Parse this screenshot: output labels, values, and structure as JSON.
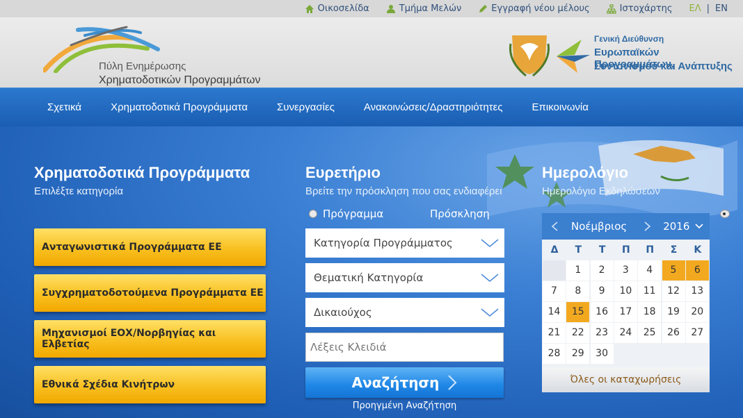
{
  "topbar": {
    "links": [
      {
        "label": "Οικοσελίδα",
        "icon": "home-icon"
      },
      {
        "label": "Τμήμα Μελών",
        "icon": "user-icon"
      },
      {
        "label": "Εγγραφή νέου μέλους",
        "icon": "pencil-icon"
      },
      {
        "label": "Ιστοχάρτης",
        "icon": "sitemap-icon"
      }
    ],
    "lang_el": "ΕΛ",
    "lang_sep": "|",
    "lang_en": "EN"
  },
  "header": {
    "logo_line1": "Πύλη Ενημέρωσης",
    "logo_line2": "Χρηματοδοτικών Προγραμμάτων",
    "org_small": "Γενική Διεύθυνση",
    "org_line1": "Ευρωπαϊκών Προγραμμάτων,",
    "org_line2": "Συντονισμού και Ανάπτυξης"
  },
  "nav": {
    "items": [
      "Σχετικά",
      "Χρηματοδοτικά Προγράμματα",
      "Συνεργασίες",
      "Ανακοινώσεις/Δραστηριότητες",
      "Επικοινωνία"
    ]
  },
  "programs": {
    "title": "Χρηματοδοτικά Προγράμματα",
    "subtitle": "Επιλέξτε κατηγορία",
    "items": [
      "Ανταγωνιστικά Προγράμματα ΕΕ",
      "Συγχρηματοδοτούμενα Προγράμματα ΕΕ",
      "Μηχανισμοί ΕΟΧ/Νορβηγίας και Ελβετίας",
      "Εθνικά Σχέδια Κινήτρων"
    ]
  },
  "index": {
    "title": "Ευρετήριο",
    "subtitle": "Βρείτε την πρόσκληση που σας ενδιαφέρει",
    "radio_program": "Πρόγραμμα",
    "radio_call": "Πρόσκληση",
    "selected_radio": "Πρόσκληση",
    "select_category": "Κατηγορία Προγράμματος",
    "select_thematic": "Θεματική Κατηγορία",
    "select_beneficiary": "Δικαιούχος",
    "keywords_placeholder": "Λέξεις Κλειδιά",
    "search_label": "Αναζήτηση",
    "advanced_label": "Προηγμένη Αναζήτηση"
  },
  "calendar": {
    "title": "Ημερολόγιο",
    "subtitle": "Ημερολόγιο Εκδηλώσεων",
    "month": "Νοέμβριος",
    "year": "2016",
    "weekdays": [
      "Δ",
      "Τ",
      "Τ",
      "Π",
      "Π",
      "Σ",
      "Κ"
    ],
    "weeks": [
      [
        "",
        "1",
        "2",
        "3",
        "4",
        "5",
        "6"
      ],
      [
        "7",
        "8",
        "9",
        "10",
        "11",
        "12",
        "13"
      ],
      [
        "14",
        "15",
        "16",
        "17",
        "18",
        "19",
        "20"
      ],
      [
        "21",
        "22",
        "23",
        "24",
        "25",
        "26",
        "27"
      ],
      [
        "28",
        "29",
        "30",
        "",
        "",
        "",
        ""
      ]
    ],
    "highlighted_days": [
      "5",
      "6",
      "15"
    ],
    "all_entries_label": "Όλες οι καταχωρήσεις"
  },
  "colors": {
    "nav_blue": "#1f63b8",
    "gold": "#f8c020",
    "lang_active": "#8fb43a"
  }
}
